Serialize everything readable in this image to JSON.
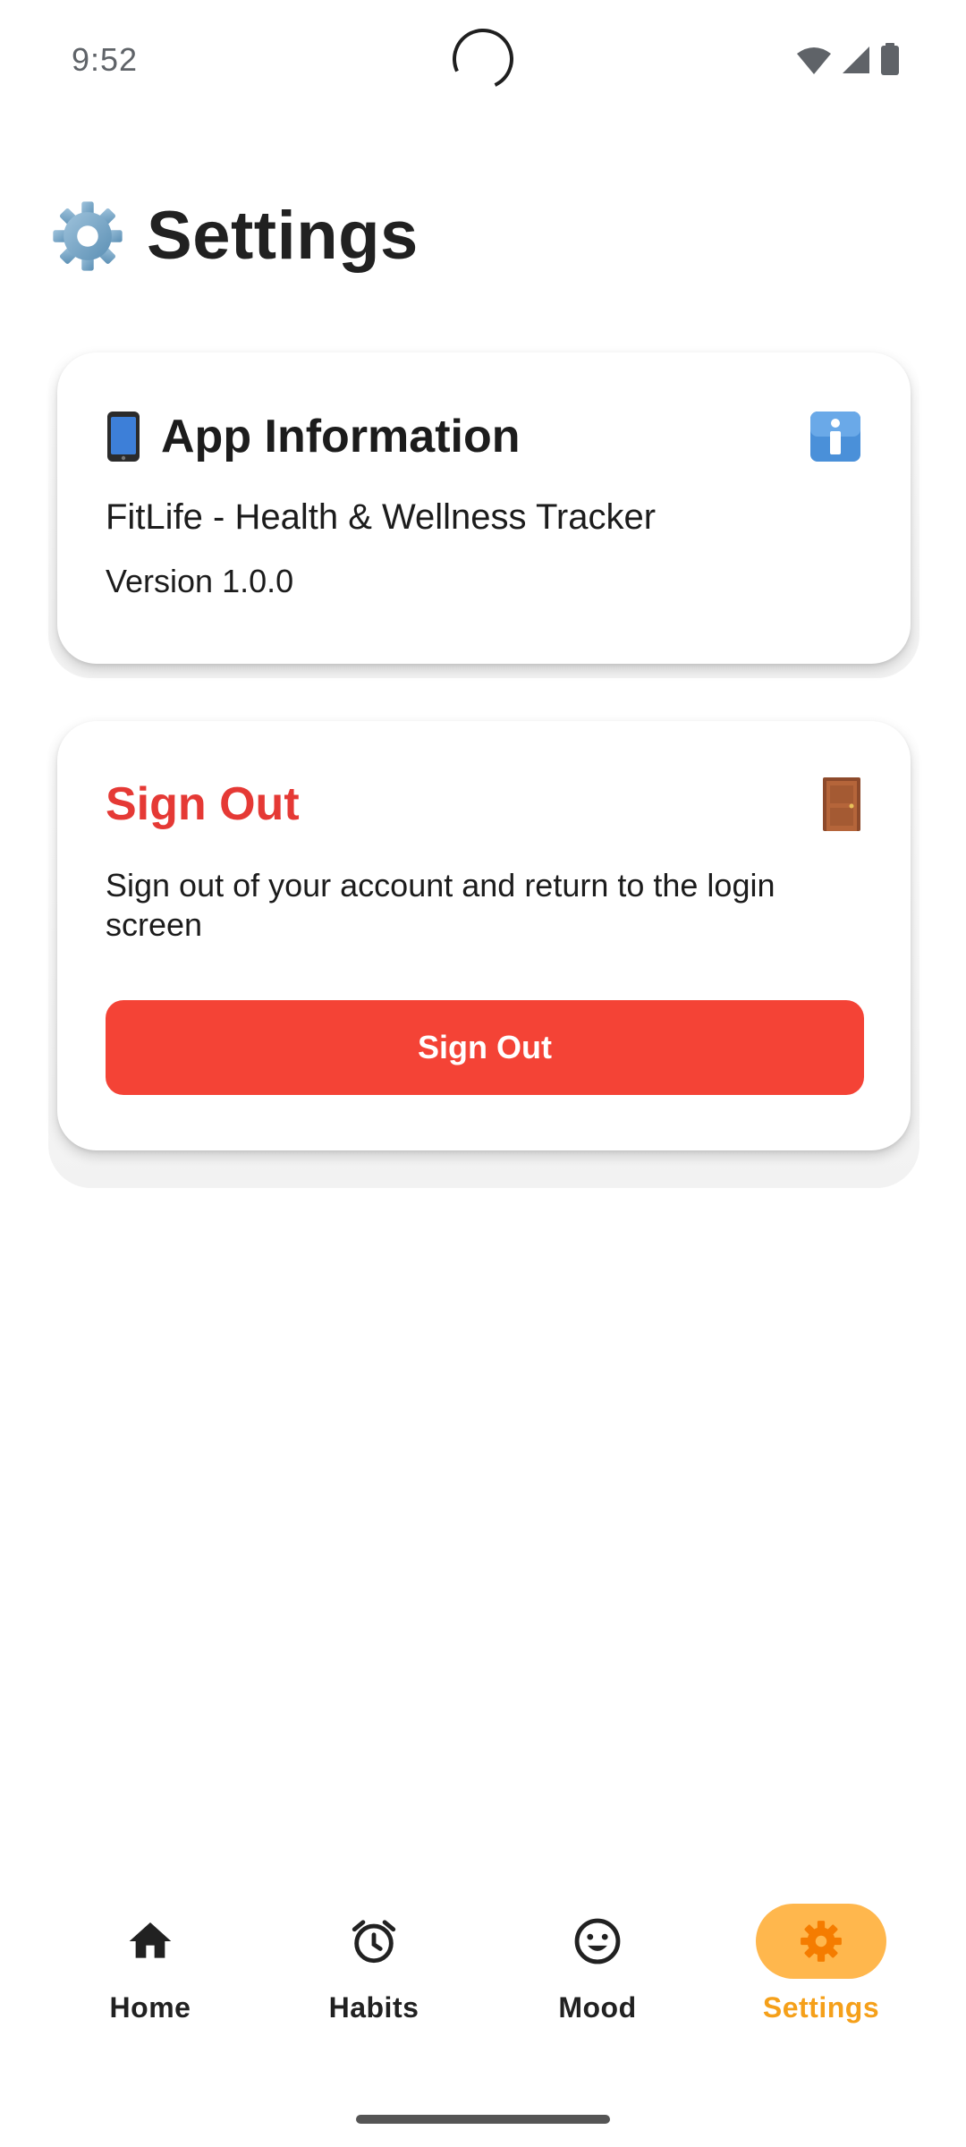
{
  "status_bar": {
    "time": "9:52",
    "icons": [
      "wifi-icon",
      "signal-icon",
      "battery-icon"
    ]
  },
  "header": {
    "icon": "gear-icon",
    "title": "Settings"
  },
  "app_info_card": {
    "icon": "mobile-phone-icon",
    "title": "App Information",
    "trailing_icon": "info-icon",
    "app_name": "FitLife - Health & Wellness Tracker",
    "version": "Version 1.0.0"
  },
  "sign_out_card": {
    "title": "Sign Out",
    "trailing_icon": "door-icon",
    "description": "Sign out of your account and return to the login screen",
    "button_label": "Sign Out"
  },
  "bottom_nav": {
    "items": [
      {
        "label": "Home",
        "icon": "home-icon",
        "active": false
      },
      {
        "label": "Habits",
        "icon": "alarm-clock-icon",
        "active": false
      },
      {
        "label": "Mood",
        "icon": "smiley-icon",
        "active": false
      },
      {
        "label": "Settings",
        "icon": "gear-icon",
        "active": true
      }
    ]
  },
  "colors": {
    "accent": "#ffb74d",
    "accent_text": "#f5a01a",
    "danger": "#f44336",
    "danger_text": "#e53935"
  }
}
